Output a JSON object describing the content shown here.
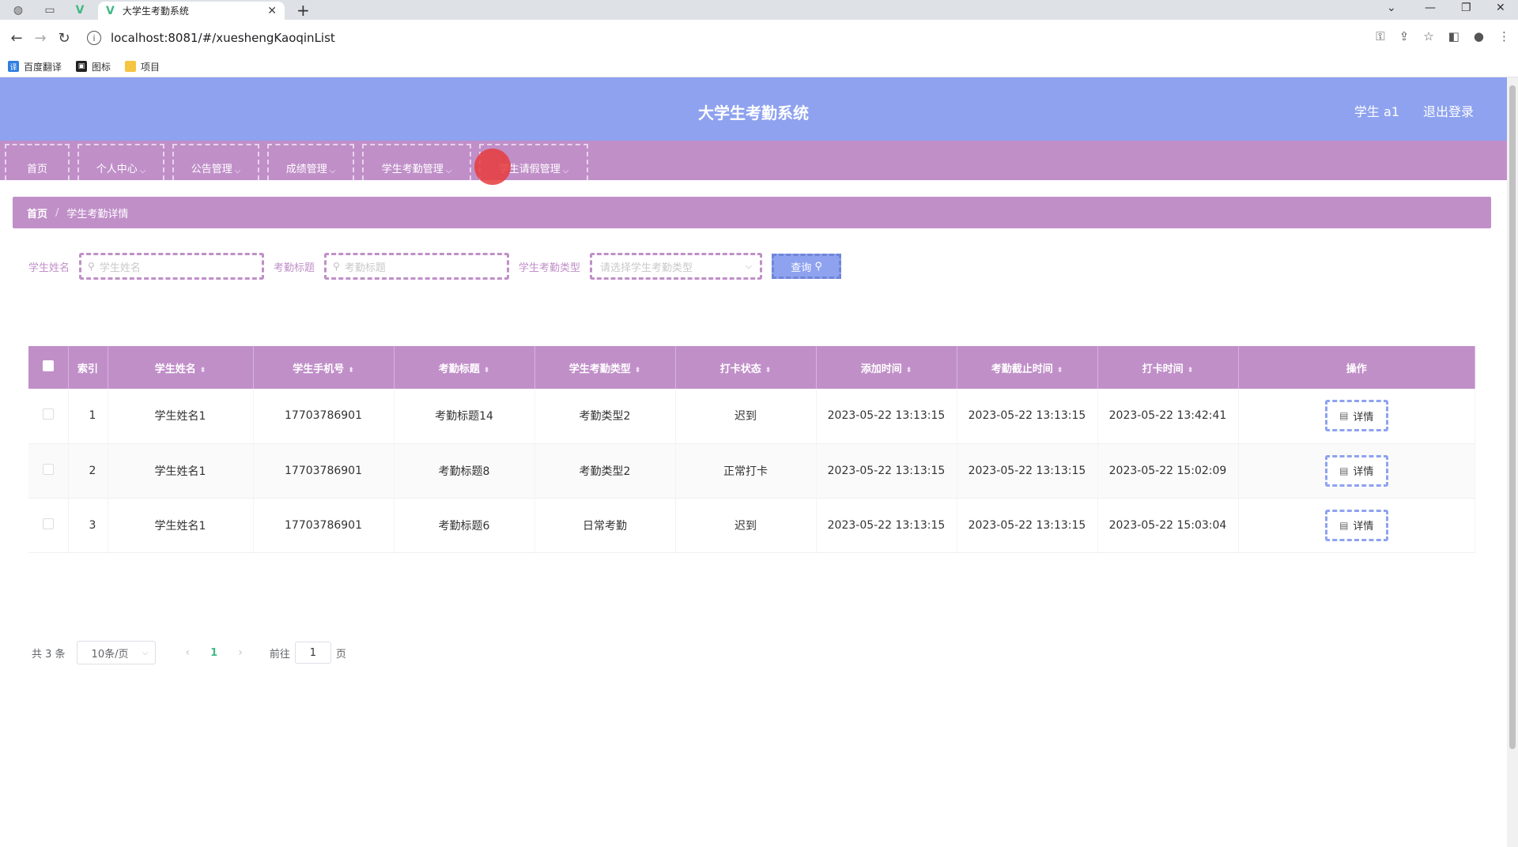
{
  "browser": {
    "tab_title": "大学生考勤系统",
    "url": "localhost:8081/#/xueshengKaoqinList",
    "bookmarks": [
      "百度翻译",
      "图标",
      "项目"
    ]
  },
  "header": {
    "title": "大学生考勤系统",
    "user": "学生 a1",
    "logout": "退出登录"
  },
  "menu": [
    {
      "label": "首页",
      "dropdown": false
    },
    {
      "label": "个人中心",
      "dropdown": true
    },
    {
      "label": "公告管理",
      "dropdown": true
    },
    {
      "label": "成绩管理",
      "dropdown": true
    },
    {
      "label": "学生考勤管理",
      "dropdown": true
    },
    {
      "label": "学生请假管理",
      "dropdown": true
    }
  ],
  "breadcrumb": {
    "home": "首页",
    "current": "学生考勤详情"
  },
  "search": {
    "name_label": "学生姓名",
    "name_placeholder": "学生姓名",
    "title_label": "考勤标题",
    "title_placeholder": "考勤标题",
    "type_label": "学生考勤类型",
    "type_placeholder": "请选择学生考勤类型",
    "query_label": "查询"
  },
  "table": {
    "columns": [
      "索引",
      "学生姓名",
      "学生手机号",
      "考勤标题",
      "学生考勤类型",
      "打卡状态",
      "添加时间",
      "考勤截止时间",
      "打卡时间",
      "操作"
    ],
    "rows": [
      {
        "index": "1",
        "name": "学生姓名1",
        "phone": "17703786901",
        "title": "考勤标题14",
        "type": "考勤类型2",
        "status": "迟到",
        "added": "2023-05-22 13:13:15",
        "deadline": "2023-05-22 13:13:15",
        "punch": "2023-05-22 13:42:41",
        "action": "详情"
      },
      {
        "index": "2",
        "name": "学生姓名1",
        "phone": "17703786901",
        "title": "考勤标题8",
        "type": "考勤类型2",
        "status": "正常打卡",
        "added": "2023-05-22 13:13:15",
        "deadline": "2023-05-22 13:13:15",
        "punch": "2023-05-22 15:02:09",
        "action": "详情"
      },
      {
        "index": "3",
        "name": "学生姓名1",
        "phone": "17703786901",
        "title": "考勤标题6",
        "type": "日常考勤",
        "status": "迟到",
        "added": "2023-05-22 13:13:15",
        "deadline": "2023-05-22 13:13:15",
        "punch": "2023-05-22 15:03:04",
        "action": "详情"
      }
    ]
  },
  "pager": {
    "total": "共 3 条",
    "page_size": "10条/页",
    "current": "1",
    "goto_label": "前往",
    "goto_value": "1",
    "page_suffix": "页"
  },
  "colors": {
    "header": "#8ea2ef",
    "menu": "#c08fc8",
    "accent_green": "#41b883"
  }
}
